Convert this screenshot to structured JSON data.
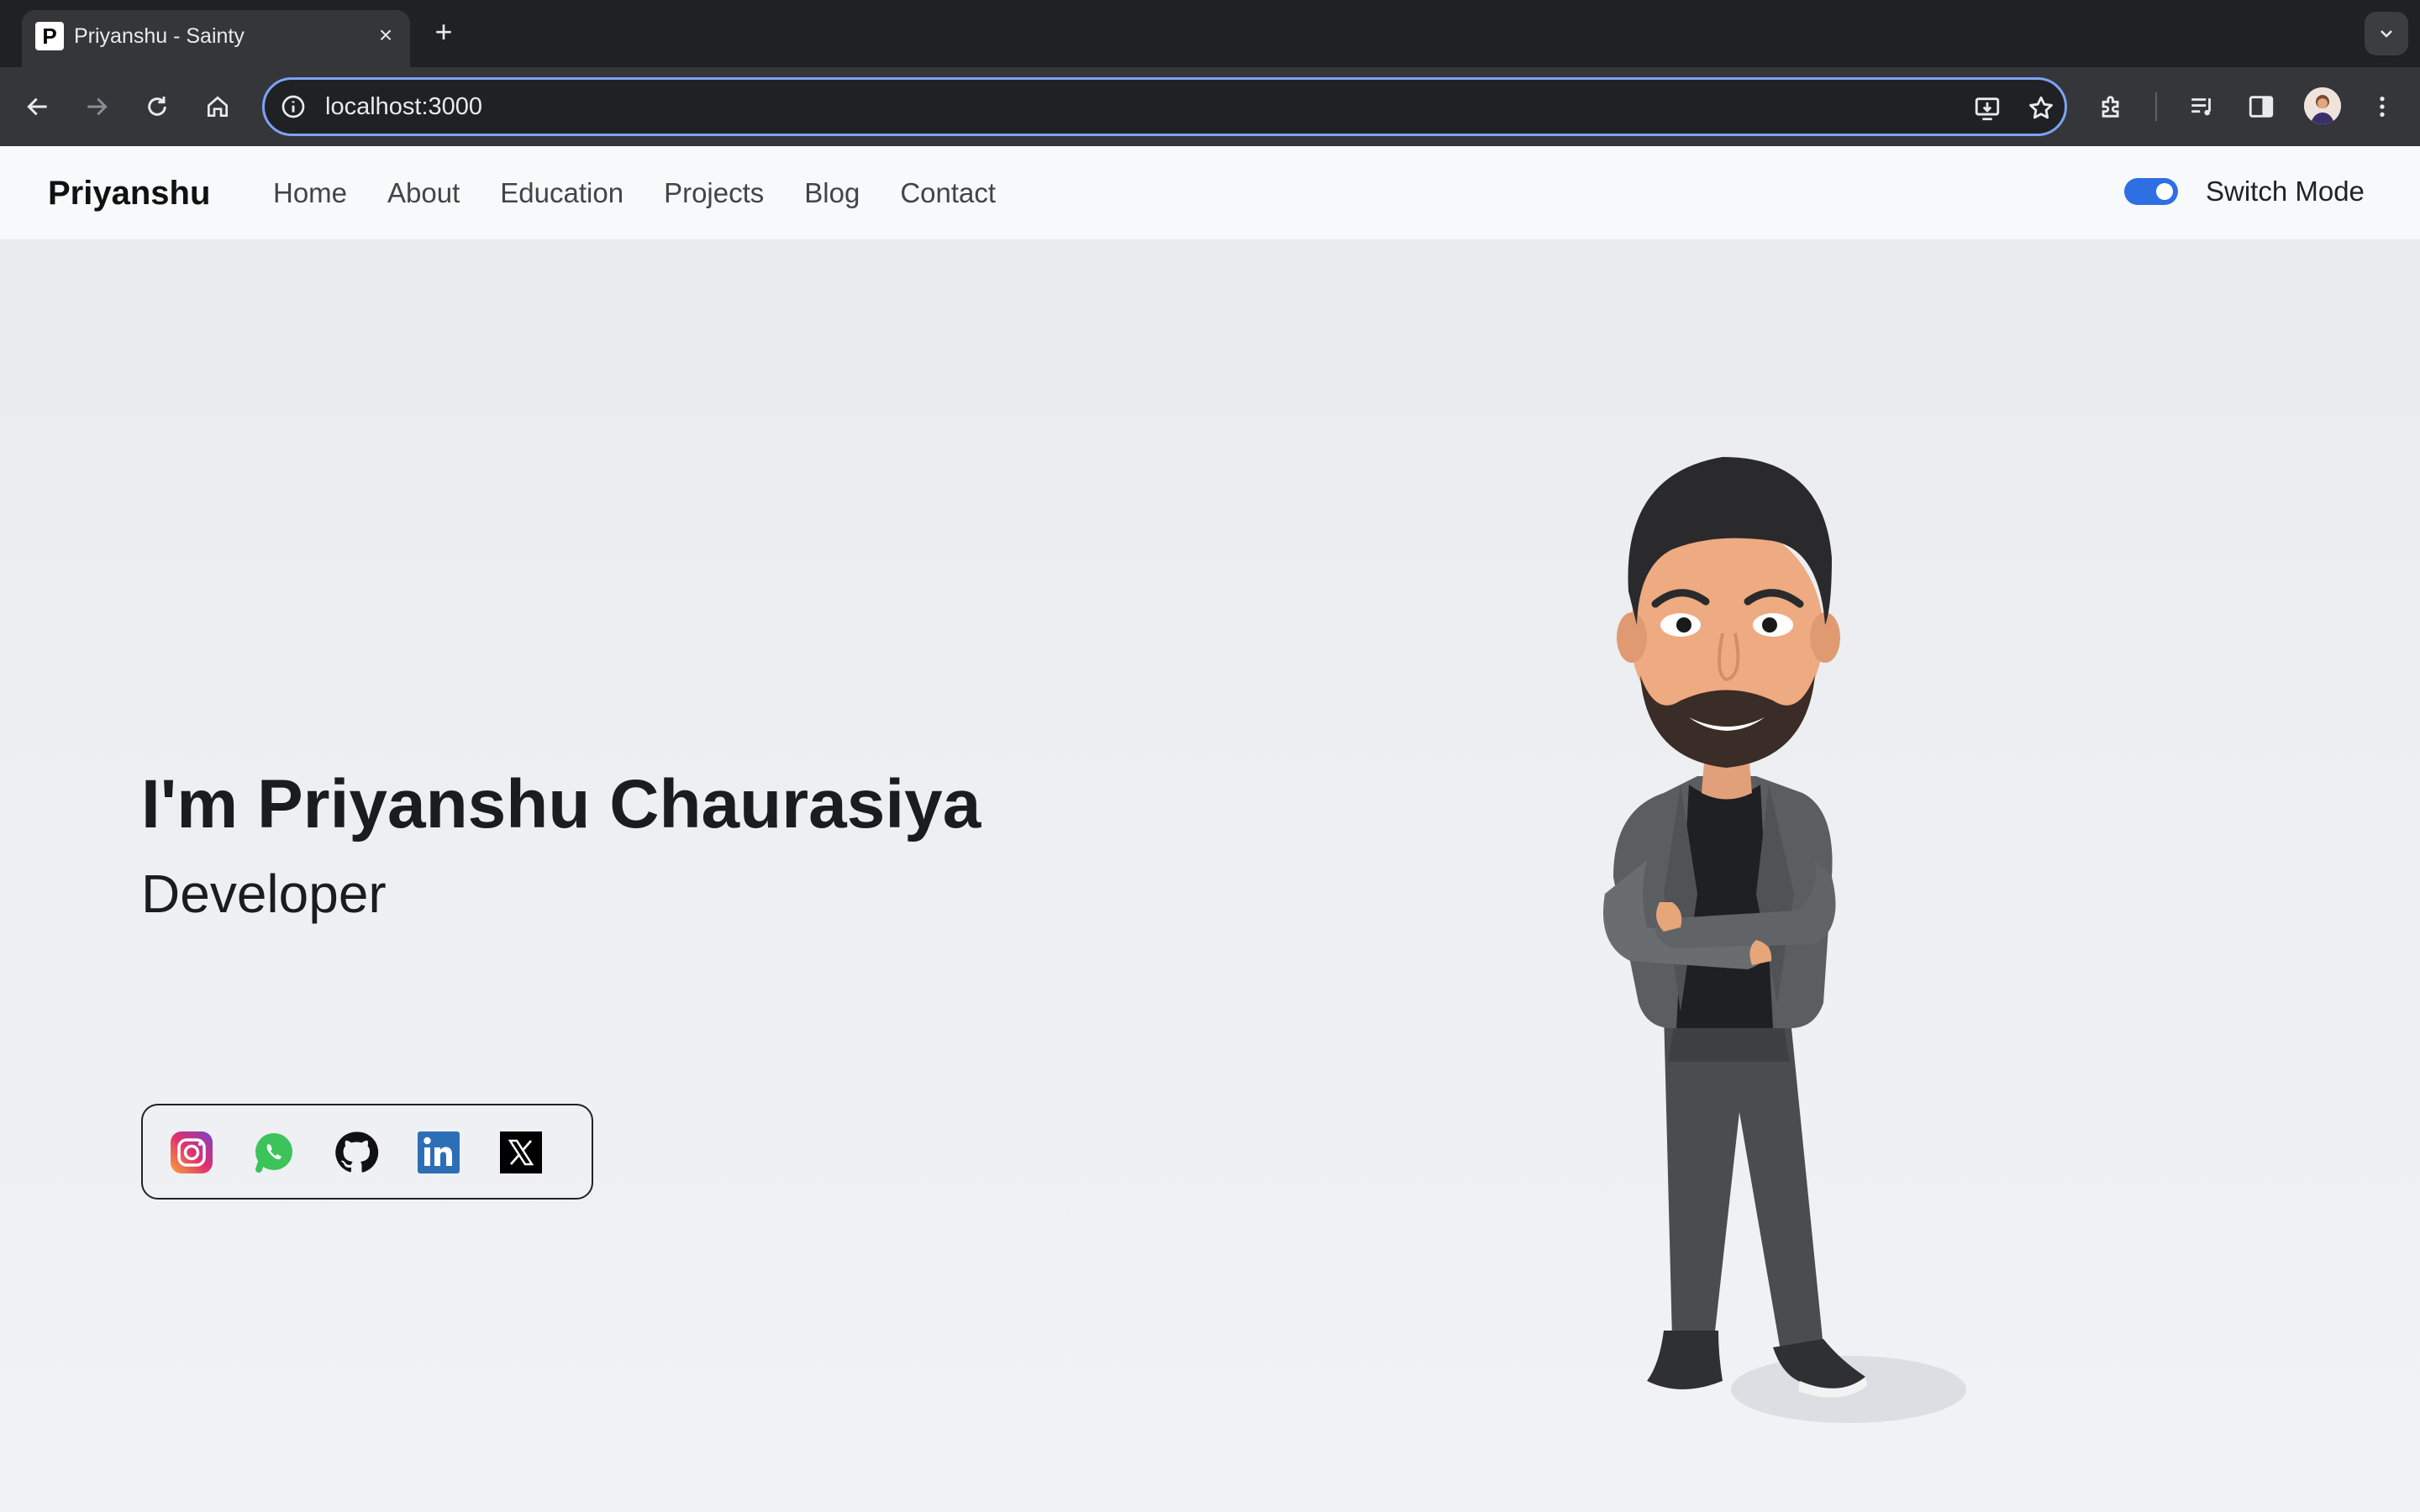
{
  "browser": {
    "tab_title": "Priyanshu - Sainty",
    "tab_favicon_letter": "P",
    "close_glyph": "×",
    "newtab_glyph": "+",
    "url": "localhost:3000"
  },
  "navbar": {
    "brand": "Priyanshu",
    "links": [
      "Home",
      "About",
      "Education",
      "Projects",
      "Blog",
      "Contact"
    ],
    "switch_label": "Switch Mode",
    "switch_on": true
  },
  "hero": {
    "title": "I'm Priyanshu Chaurasiya",
    "subtitle": "Developer"
  },
  "socials": [
    "instagram-icon",
    "whatsapp-icon",
    "github-icon",
    "linkedin-icon",
    "x-icon"
  ],
  "colors": {
    "accent": "#2f6fe4",
    "omnibox_border": "#7ca3f5",
    "text": "#1b1c1d"
  }
}
